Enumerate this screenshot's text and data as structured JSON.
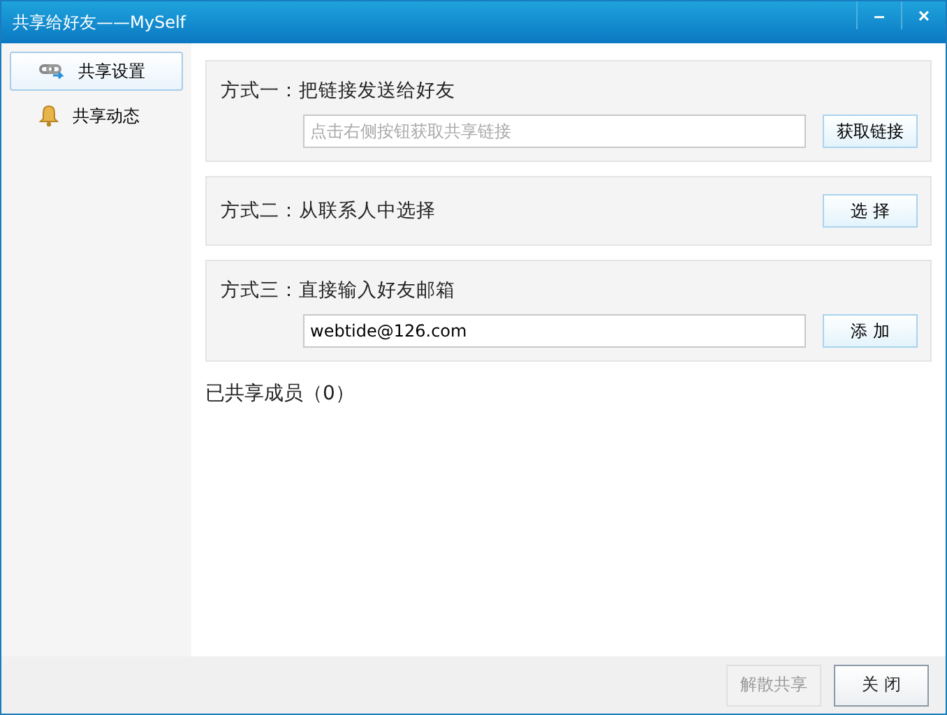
{
  "window": {
    "title": "共享给好友——MySelf",
    "controls": [
      "–",
      "×"
    ]
  },
  "sidebar": {
    "items": [
      {
        "label": "共享设置",
        "selected": true
      },
      {
        "label": "共享动态",
        "selected": false
      }
    ]
  },
  "sections": [
    {
      "kind": "field",
      "label": "方式一：把链接发送给好友",
      "field": {
        "placeholder": "点击右侧按钮获取共享链接"
      },
      "button": "获取链接"
    },
    {
      "kind": "inline",
      "label": "方式二：从联系人中选择",
      "button": "选 择"
    },
    {
      "kind": "field",
      "label": "方式三：直接输入好友邮箱",
      "field": {
        "value": "webtide@126.com"
      },
      "button": "添 加"
    }
  ],
  "members": "已共享成员（0）",
  "footer": {
    "buttons": [
      {
        "label": "解散共享",
        "disabled": true
      },
      {
        "label": "关 闭",
        "disabled": false
      }
    ]
  }
}
